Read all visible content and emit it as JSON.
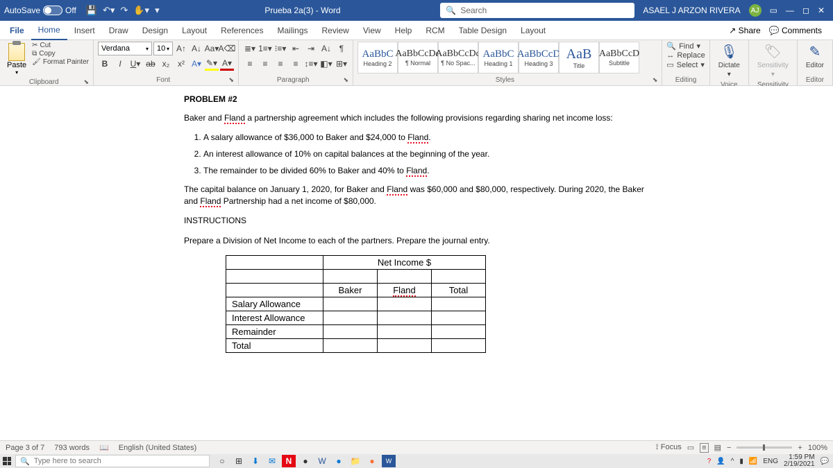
{
  "titlebar": {
    "autosave": "AutoSave",
    "autosave_state": "Off",
    "doc_name": "Prueba 2a(3) - Word",
    "search_placeholder": "Search",
    "user": "ASAEL J ARZON RIVERA",
    "avatar": "AJ"
  },
  "tabs": {
    "file": "File",
    "home": "Home",
    "insert": "Insert",
    "draw": "Draw",
    "design": "Design",
    "layout": "Layout",
    "references": "References",
    "mailings": "Mailings",
    "review": "Review",
    "view": "View",
    "help": "Help",
    "rcm": "RCM",
    "table_design": "Table Design",
    "layout2": "Layout",
    "share": "Share",
    "comments": "Comments"
  },
  "ribbon": {
    "clipboard": {
      "label": "Clipboard",
      "paste": "Paste",
      "cut": "Cut",
      "copy": "Copy",
      "format_painter": "Format Painter"
    },
    "font": {
      "label": "Font",
      "name": "Verdana",
      "size": "10"
    },
    "paragraph": {
      "label": "Paragraph"
    },
    "styles": {
      "label": "Styles",
      "items": [
        {
          "preview": "AaBbC",
          "name": "Heading 2",
          "cls": "med"
        },
        {
          "preview": "AaBbCcDd",
          "name": "¶ Normal",
          "cls": ""
        },
        {
          "preview": "AaBbCcDd",
          "name": "¶ No Spac...",
          "cls": ""
        },
        {
          "preview": "AaBbC",
          "name": "Heading 1",
          "cls": "med"
        },
        {
          "preview": "AaBbCcD",
          "name": "Heading 3",
          "cls": "med"
        },
        {
          "preview": "AaB",
          "name": "Title",
          "cls": "big"
        },
        {
          "preview": "AaBbCcD",
          "name": "Subtitle",
          "cls": ""
        }
      ]
    },
    "editing": {
      "label": "Editing",
      "find": "Find",
      "replace": "Replace",
      "select": "Select"
    },
    "dictate": "Dictate",
    "sensitivity": "Sensitivity",
    "editor": "Editor",
    "voice": "Voice",
    "sensitivity2": "Sensitivity",
    "editor2": "Editor"
  },
  "doc": {
    "title": "PROBLEM #2",
    "intro1": "Baker and ",
    "intro_fland": "Fland",
    "intro2": " a partnership agreement which includes the following provisions regarding sharing net income loss:",
    "li1a": "A salary allowance of $36,000 to Baker and $24,000 to ",
    "li1b": "Fland",
    "li1c": ".",
    "li2": "An interest allowance of 10% on capital balances at the beginning of the year.",
    "li3a": "The remainder to be divided 60% to Baker and 40% to ",
    "li3b": "Fland",
    "li3c": ".",
    "p2a": "The capital balance on January 1, 2020, for Baker and ",
    "p2b": "Fland",
    "p2c": " was $60,000 and $80,000, respectively. During 2020, the Baker and ",
    "p2d": "Fland",
    "p2e": " Partnership had a net income of $80,000.",
    "instr_h": "INSTRUCTIONS",
    "instr": "Prepare a Division of Net Income to each of the partners. Prepare the journal entry.",
    "table": {
      "net_income": "Net Income $",
      "baker": "Baker",
      "fland": "Fland",
      "total": "Total",
      "r1": "Salary Allowance",
      "r2": "Interest Allowance",
      "r3": "Remainder",
      "r4": "Total"
    }
  },
  "status": {
    "page": "Page 3 of 7",
    "words": "793 words",
    "lang": "English (United States)",
    "focus": "Focus",
    "zoom": "100%"
  },
  "taskbar": {
    "search": "Type here to search",
    "lang": "ENG",
    "time": "1:59 PM",
    "date": "2/19/2021"
  }
}
